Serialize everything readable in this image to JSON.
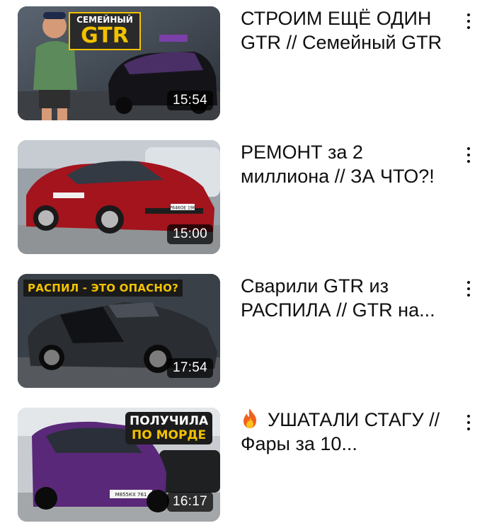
{
  "colors": {
    "duration_bg": "#000000",
    "accent_yellow": "#f2c200",
    "accent_red": "#d8241f"
  },
  "videos": [
    {
      "title": "СТРОИМ ЕЩЁ ОДИН GTR // Семейный GTR",
      "duration": "15:54",
      "thumb_text_top": "СЕМЕЙНЫЙ",
      "thumb_text_big": "GTR",
      "menu_icon": "more-vert-icon"
    },
    {
      "title": "РЕМОНТ за 2 миллиона // ЗА ЧТО?!",
      "duration": "15:00",
      "plate_text": "Р646ОЕ 196",
      "menu_icon": "more-vert-icon"
    },
    {
      "title": "Сварили GTR из РАСПИЛА // GTR на...",
      "duration": "17:54",
      "thumb_text": "РАСПИЛ - ЭТО ОПАСНО?",
      "menu_icon": "more-vert-icon"
    },
    {
      "title": "УШАТАЛИ СТАГУ // Фары за 10...",
      "title_icon": "fire-emoji-icon",
      "duration": "16:17",
      "thumb_text_line1": "ПОЛУЧИЛА",
      "thumb_text_line2": "ПО МОРДЕ",
      "plate_text": "М855КХ 761",
      "menu_icon": "more-vert-icon"
    }
  ]
}
